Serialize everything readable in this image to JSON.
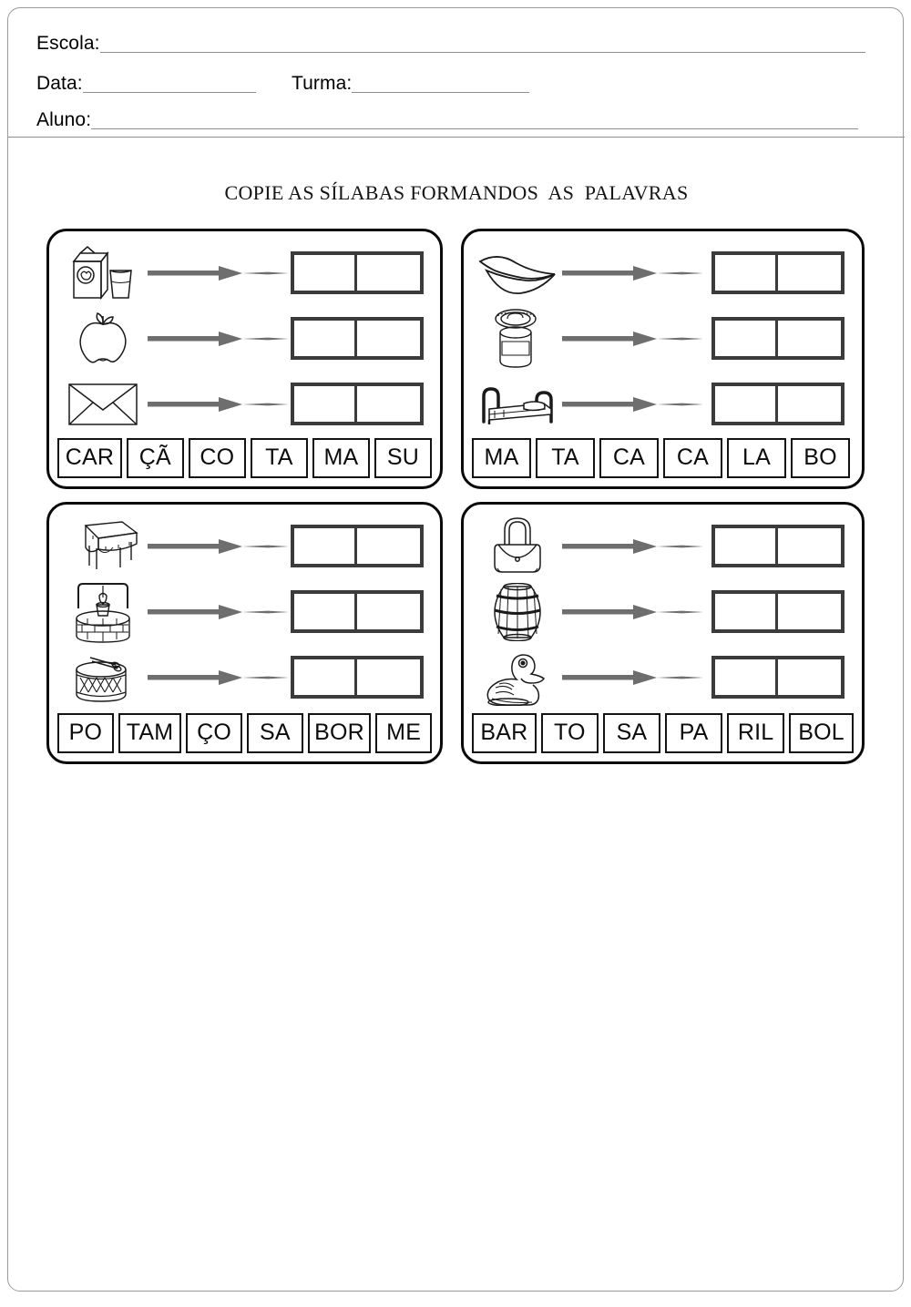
{
  "header": {
    "fields": [
      {
        "label": "Escola:",
        "value": ""
      },
      {
        "label": "Data:",
        "value": ""
      },
      {
        "label": "Turma:",
        "value": ""
      },
      {
        "label": "Aluno:",
        "value": ""
      }
    ]
  },
  "title": "COPIE AS SÍLABAS FORMANDOS  AS  PALAVRAS",
  "colors": {
    "page_border": "#9a9a9a",
    "panel_border": "#0a0a0a",
    "answer_box_border": "#3b3b3b",
    "arrow": "#6e6e6e",
    "tile_border": "#131313",
    "text": "#0c0c0c"
  },
  "exercises": [
    {
      "id": "quadrant-1",
      "position": "top-left",
      "rows": [
        {
          "picture": "milk-carton-and-glass-icon",
          "answer_cells": [
            "",
            ""
          ]
        },
        {
          "picture": "apple-icon",
          "answer_cells": [
            "",
            ""
          ]
        },
        {
          "picture": "envelope-icon",
          "answer_cells": [
            "",
            ""
          ]
        }
      ],
      "syllables": [
        "CAR",
        "ÇÃ",
        "CO",
        "TA",
        "MA",
        "SU"
      ]
    },
    {
      "id": "quadrant-2",
      "position": "top-right",
      "rows": [
        {
          "picture": "lips-icon",
          "answer_cells": [
            "",
            ""
          ]
        },
        {
          "picture": "tin-can-icon",
          "answer_cells": [
            "",
            ""
          ]
        },
        {
          "picture": "bed-icon",
          "answer_cells": [
            "",
            ""
          ]
        }
      ],
      "syllables": [
        "MA",
        "TA",
        "CA",
        "CA",
        "LA",
        "BO"
      ]
    },
    {
      "id": "quadrant-3",
      "position": "bottom-left",
      "rows": [
        {
          "picture": "table-with-tablecloth-icon",
          "answer_cells": [
            "",
            ""
          ]
        },
        {
          "picture": "water-well-icon",
          "answer_cells": [
            "",
            ""
          ]
        },
        {
          "picture": "drum-icon",
          "answer_cells": [
            "",
            ""
          ]
        }
      ],
      "syllables": [
        "PO",
        "TAM",
        "ÇO",
        "SA",
        "BOR",
        "ME"
      ]
    },
    {
      "id": "quadrant-4",
      "position": "bottom-right",
      "rows": [
        {
          "picture": "handbag-icon",
          "answer_cells": [
            "",
            ""
          ]
        },
        {
          "picture": "barrel-icon",
          "answer_cells": [
            "",
            ""
          ]
        },
        {
          "picture": "duck-icon",
          "answer_cells": [
            "",
            ""
          ]
        }
      ],
      "syllables": [
        "BAR",
        "TO",
        "SA",
        "PA",
        "RIL",
        "BOL"
      ]
    }
  ]
}
